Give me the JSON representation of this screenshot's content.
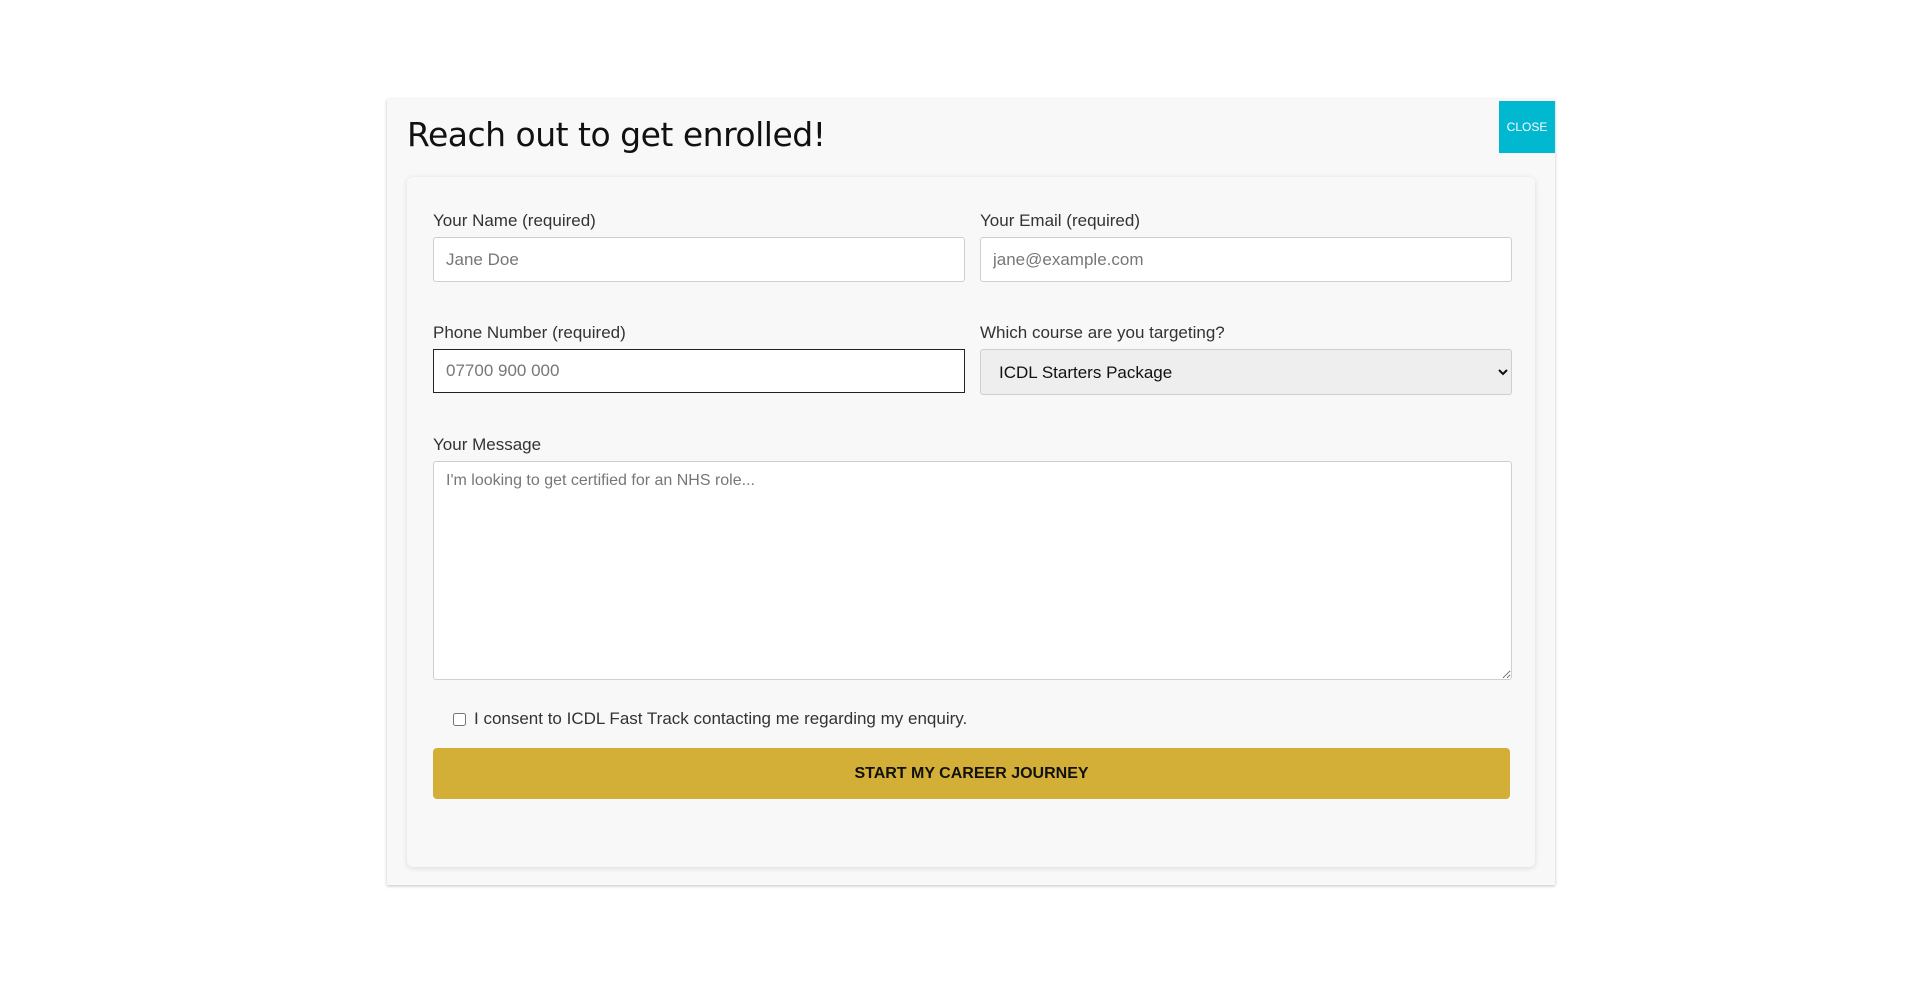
{
  "modal": {
    "title": "Reach out to get enrolled!",
    "close_label": "CLOSE"
  },
  "form": {
    "name": {
      "label": "Your Name (required)",
      "placeholder": "Jane Doe"
    },
    "email": {
      "label": "Your Email (required)",
      "placeholder": "jane@example.com"
    },
    "phone": {
      "label": "Phone Number (required)",
      "placeholder": "07700 900 000"
    },
    "course": {
      "label": "Which course are you targeting?",
      "selected": "ICDL Starters Package"
    },
    "message": {
      "label": "Your Message",
      "placeholder": "I'm looking to get certified for an NHS role..."
    },
    "consent_label": "I consent to ICDL Fast Track contacting me regarding my enquiry.",
    "submit_label": "START MY CAREER JOURNEY"
  },
  "colors": {
    "close_button": "#00b8cf",
    "submit_button": "#d4af37",
    "modal_background": "#f8f8f8"
  }
}
